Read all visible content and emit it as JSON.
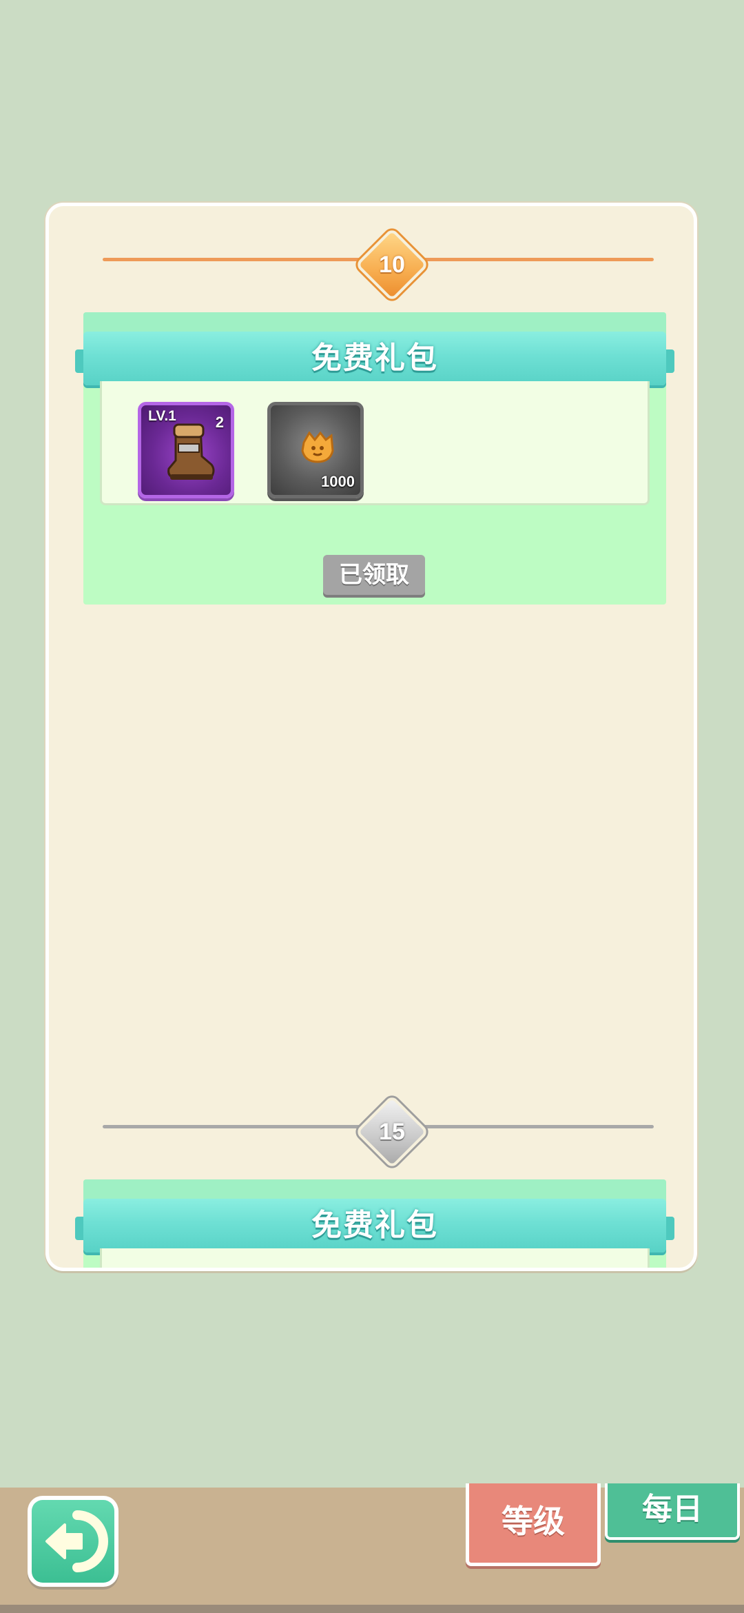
{
  "rewards": [
    {
      "level": "10",
      "level_state": "reached",
      "pack_title": "免费礼包",
      "items": [
        {
          "icon": "boots-icon",
          "level_label": "LV.1",
          "count": "2",
          "rarity_color": "#b466e6"
        },
        {
          "icon": "gold-coin-icon",
          "amount": "1000",
          "rarity_color": "#6c6c6c"
        }
      ],
      "button_label": "已领取"
    },
    {
      "level": "15",
      "level_state": "locked",
      "pack_title": "免费礼包"
    }
  ],
  "nav": {
    "back_icon": "back-arrow-icon",
    "tab_level_label": "等级",
    "tab_daily_label": "每日",
    "active_tab": "等级"
  },
  "colors": {
    "background": "#cbdcc4",
    "panel": "#f6f0dc",
    "ribbon": "#6ee0d4",
    "card": "#bdfcc3",
    "level_reached": "#f7ad4f",
    "level_locked": "#c9c9c9",
    "tab_level": "#e8887a",
    "tab_daily": "#4fbf96"
  }
}
